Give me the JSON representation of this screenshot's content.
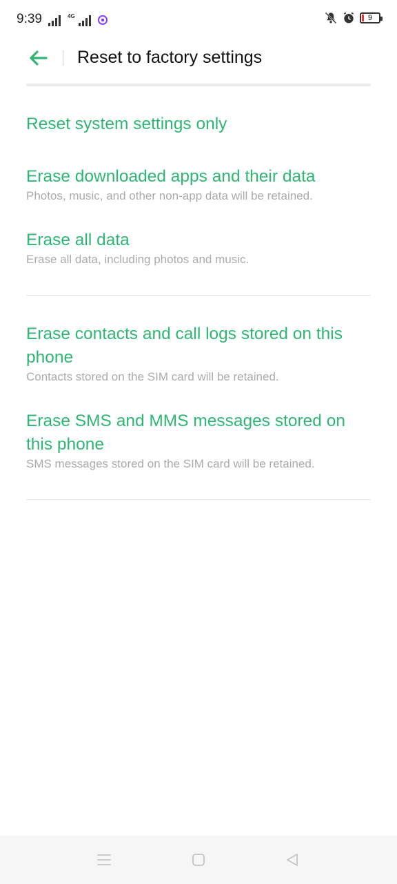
{
  "status_bar": {
    "time": "9:39",
    "network": "4G",
    "battery": "9"
  },
  "header": {
    "title": "Reset to factory settings"
  },
  "options": [
    {
      "title": "Reset system settings only",
      "description": ""
    },
    {
      "title": "Erase downloaded apps and their data",
      "description": "Photos, music, and other non-app data will be retained."
    },
    {
      "title": "Erase all data",
      "description": "Erase all data, including photos and music."
    },
    {
      "title": "Erase contacts and call logs stored on this phone",
      "description": "Contacts stored on the SIM card will be retained."
    },
    {
      "title": "Erase SMS and MMS messages stored on this phone",
      "description": "SMS messages stored on the SIM card will be retained."
    }
  ],
  "icons": {
    "back": "arrow-left-icon",
    "notifications_off": "bell-off-icon",
    "alarm": "alarm-icon",
    "messenger": "messenger-icon",
    "nav_menu": "menu-icon",
    "nav_home": "home-icon",
    "nav_back": "triangle-back-icon"
  },
  "colors": {
    "accent": "#2fb673",
    "description": "#ababab",
    "title": "#111111"
  }
}
